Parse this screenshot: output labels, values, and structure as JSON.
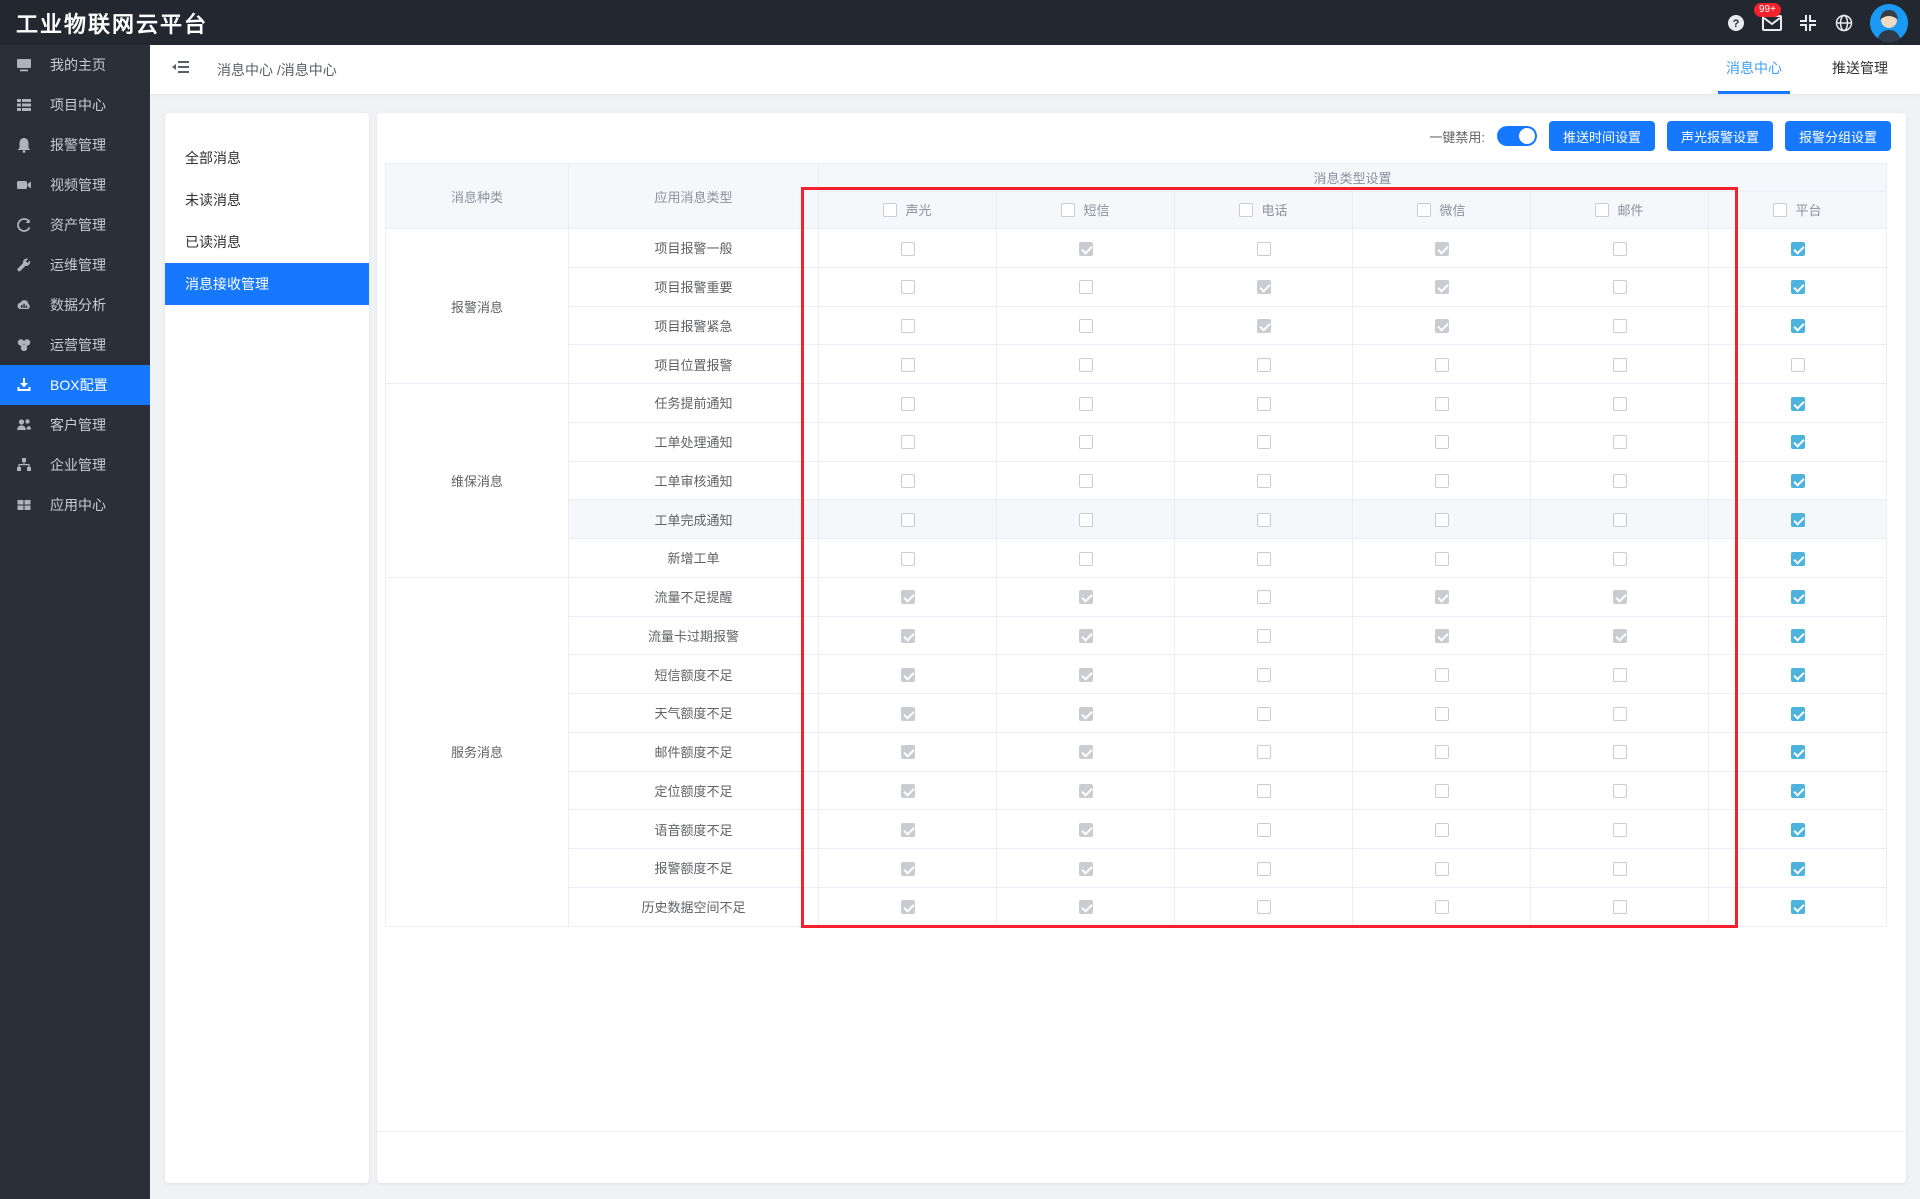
{
  "topbar": {
    "title": "工业物联网云平台",
    "badge": "99+",
    "icons": [
      "help-icon",
      "mail-icon",
      "compress-icon",
      "globe-icon"
    ]
  },
  "sidebar": {
    "items": [
      {
        "label": "我的主页",
        "icon": "monitor-icon",
        "active": false
      },
      {
        "label": "项目中心",
        "icon": "project-list-icon",
        "active": false
      },
      {
        "label": "报警管理",
        "icon": "bell-icon",
        "active": false
      },
      {
        "label": "视频管理",
        "icon": "video-camera-icon",
        "active": false
      },
      {
        "label": "资产管理",
        "icon": "asset-recycle-icon",
        "active": false
      },
      {
        "label": "运维管理",
        "icon": "wrench-icon",
        "active": false
      },
      {
        "label": "数据分析",
        "icon": "cloud-chart-icon",
        "active": false
      },
      {
        "label": "运营管理",
        "icon": "circles-icon",
        "active": false
      },
      {
        "label": "BOX配置",
        "icon": "download-icon",
        "active": true
      },
      {
        "label": "客户管理",
        "icon": "users-icon",
        "active": false
      },
      {
        "label": "企业管理",
        "icon": "sitemap-icon",
        "active": false
      },
      {
        "label": "应用中心",
        "icon": "grid-icon",
        "active": false
      }
    ]
  },
  "breadcrumb": {
    "text": "消息中心 /消息中心"
  },
  "tabs": [
    {
      "label": "消息中心",
      "active": true
    },
    {
      "label": "推送管理",
      "active": false
    }
  ],
  "message_menu": [
    {
      "label": "全部消息",
      "active": false
    },
    {
      "label": "未读消息",
      "active": false
    },
    {
      "label": "已读消息",
      "active": false
    },
    {
      "label": "消息接收管理",
      "active": true
    }
  ],
  "toolbar": {
    "disable_label": "一键禁用:",
    "toggle_on": true,
    "buttons": [
      "推送时间设置",
      "声光报警设置",
      "报警分组设置"
    ]
  },
  "table": {
    "category_header": "消息种类",
    "type_header": "应用消息类型",
    "group_header": "消息类型设置",
    "channels": [
      "声光",
      "短信",
      "电话",
      "微信",
      "邮件",
      "平台"
    ],
    "state_legend": {
      "0": "unchecked",
      "1": "checked-disabled-gray",
      "2": "checked-blue"
    },
    "groups": [
      {
        "name": "报警消息",
        "rows": [
          {
            "label": "项目报警一般",
            "states": [
              0,
              1,
              0,
              1,
              0,
              2
            ],
            "highlight": false
          },
          {
            "label": "项目报警重要",
            "states": [
              0,
              0,
              1,
              1,
              0,
              2
            ],
            "highlight": false
          },
          {
            "label": "项目报警紧急",
            "states": [
              0,
              0,
              1,
              1,
              0,
              2
            ],
            "highlight": false
          },
          {
            "label": "项目位置报警",
            "states": [
              0,
              0,
              0,
              0,
              0,
              0
            ],
            "highlight": false
          }
        ]
      },
      {
        "name": "维保消息",
        "rows": [
          {
            "label": "任务提前通知",
            "states": [
              0,
              0,
              0,
              0,
              0,
              2
            ],
            "highlight": false
          },
          {
            "label": "工单处理通知",
            "states": [
              0,
              0,
              0,
              0,
              0,
              2
            ],
            "highlight": false
          },
          {
            "label": "工单审核通知",
            "states": [
              0,
              0,
              0,
              0,
              0,
              2
            ],
            "highlight": false
          },
          {
            "label": "工单完成通知",
            "states": [
              0,
              0,
              0,
              0,
              0,
              2
            ],
            "highlight": true
          },
          {
            "label": "新增工单",
            "states": [
              0,
              0,
              0,
              0,
              0,
              2
            ],
            "highlight": false
          }
        ]
      },
      {
        "name": "服务消息",
        "rows": [
          {
            "label": "流量不足提醒",
            "states": [
              1,
              1,
              0,
              1,
              1,
              2
            ],
            "highlight": false
          },
          {
            "label": "流量卡过期报警",
            "states": [
              1,
              1,
              0,
              1,
              1,
              2
            ],
            "highlight": false
          },
          {
            "label": "短信额度不足",
            "states": [
              1,
              1,
              0,
              0,
              0,
              2
            ],
            "highlight": false
          },
          {
            "label": "天气额度不足",
            "states": [
              1,
              1,
              0,
              0,
              0,
              2
            ],
            "highlight": false
          },
          {
            "label": "邮件额度不足",
            "states": [
              1,
              1,
              0,
              0,
              0,
              2
            ],
            "highlight": false
          },
          {
            "label": "定位额度不足",
            "states": [
              1,
              1,
              0,
              0,
              0,
              2
            ],
            "highlight": false
          },
          {
            "label": "语音额度不足",
            "states": [
              1,
              1,
              0,
              0,
              0,
              2
            ],
            "highlight": false
          },
          {
            "label": "报警额度不足",
            "states": [
              1,
              1,
              0,
              0,
              0,
              2
            ],
            "highlight": false
          },
          {
            "label": "历史数据空间不足",
            "states": [
              1,
              1,
              0,
              0,
              0,
              2
            ],
            "highlight": false
          }
        ]
      }
    ]
  },
  "colors": {
    "primary_blue": "#1677ff",
    "tab_blue": "#409eff",
    "platform_check_blue": "#4eb3dc",
    "disabled_check_gray": "#c9ccd1",
    "badge_red": "#f5222d",
    "highlight_rect_red": "#f5222d",
    "topbar_bg": "#23272f",
    "sidebar_bg": "#2a2f3a",
    "header_bg": "#f5f7fa"
  }
}
